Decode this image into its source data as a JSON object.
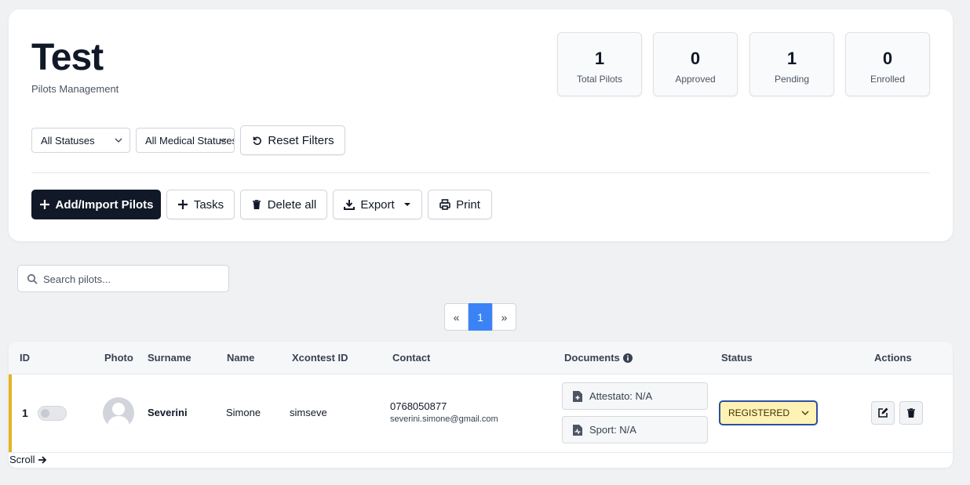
{
  "header": {
    "title": "Test",
    "subtitle": "Pilots Management"
  },
  "stats": [
    {
      "value": "1",
      "label": "Total Pilots"
    },
    {
      "value": "0",
      "label": "Approved"
    },
    {
      "value": "1",
      "label": "Pending"
    },
    {
      "value": "0",
      "label": "Enrolled"
    }
  ],
  "filters": {
    "status_select": "All Statuses",
    "medical_select": "All Medical Statuses",
    "reset_label": "Reset Filters"
  },
  "toolbar": {
    "add_import_label": "Add/Import Pilots",
    "tasks_label": "Tasks",
    "delete_all_label": "Delete all",
    "export_label": "Export",
    "print_label": "Print"
  },
  "search": {
    "placeholder": "Search pilots..."
  },
  "pagination": {
    "prev": "«",
    "current": "1",
    "next": "»"
  },
  "table": {
    "columns": [
      "ID",
      "Photo",
      "Surname",
      "Name",
      "Xcontest ID",
      "Contact",
      "Documents",
      "Status",
      "Actions"
    ],
    "rows": [
      {
        "id": "1",
        "surname": "Severini",
        "name": "Simone",
        "xcontest_id": "simseve",
        "phone": "0768050877",
        "email": "severini.simone@gmail.com",
        "documents": [
          "Attestato: N/A",
          "Sport: N/A"
        ],
        "status": "REGISTERED"
      }
    ]
  },
  "scroll_hint": "Scroll",
  "colors": {
    "primary_dark": "#111827",
    "accent_blue": "#3b82f6",
    "row_accent": "#e4b320",
    "status_bg": "#fef3b4",
    "status_border": "#2d4ea3"
  }
}
